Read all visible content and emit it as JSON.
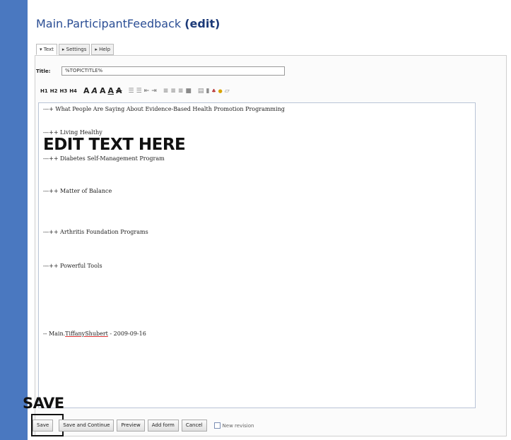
{
  "page": {
    "title_prefix": "Main.ParticipantFeedback",
    "title_edit": "(edit)"
  },
  "tabs": [
    {
      "label": "▾ Text",
      "active": true
    },
    {
      "label": "▸ Settings",
      "active": false
    },
    {
      "label": "▸ Help",
      "active": false
    }
  ],
  "title_field": {
    "label": "Title:",
    "value": "%TOPICTITLE%"
  },
  "toolbar": {
    "h1": "H1",
    "h2": "H2",
    "h3": "H3",
    "h4": "H4",
    "icons": [
      "bold-icon",
      "italic-icon",
      "bold-alt-icon",
      "underline-icon",
      "strikethrough-icon",
      "bullet-list-icon",
      "numbered-list-icon",
      "outdent-icon",
      "indent-icon",
      "align-left-icon",
      "align-center-icon",
      "align-right-icon",
      "justify-icon",
      "paste-icon",
      "link-icon",
      "anchor-icon",
      "globe-icon",
      "image-icon"
    ]
  },
  "editor": {
    "lines": [
      "---+ What People Are Saying About Evidence-Based Health Promotion Programming",
      "---++ Living Healthy",
      "---++ Diabetes Self-Management Program",
      "---++ Matter of Balance",
      "---++ Arthritis Foundation Programs",
      "---++ Powerful Tools"
    ],
    "signature_prefix": "-- Main.",
    "signature_name": "TiffanyShubert",
    "signature_suffix": " - 2009-09-16"
  },
  "annotations": {
    "edit_text": "EDIT TEXT HERE",
    "save": "SAVE"
  },
  "buttons": {
    "save": "Save",
    "save_continue": "Save and Continue",
    "preview": "Preview",
    "add_form": "Add form",
    "cancel": "Cancel",
    "new_revision": "New revision"
  },
  "colors": {
    "left_bar": "#4a78c0",
    "title": "#2a4d94",
    "editor_border": "#b9c4d6"
  }
}
